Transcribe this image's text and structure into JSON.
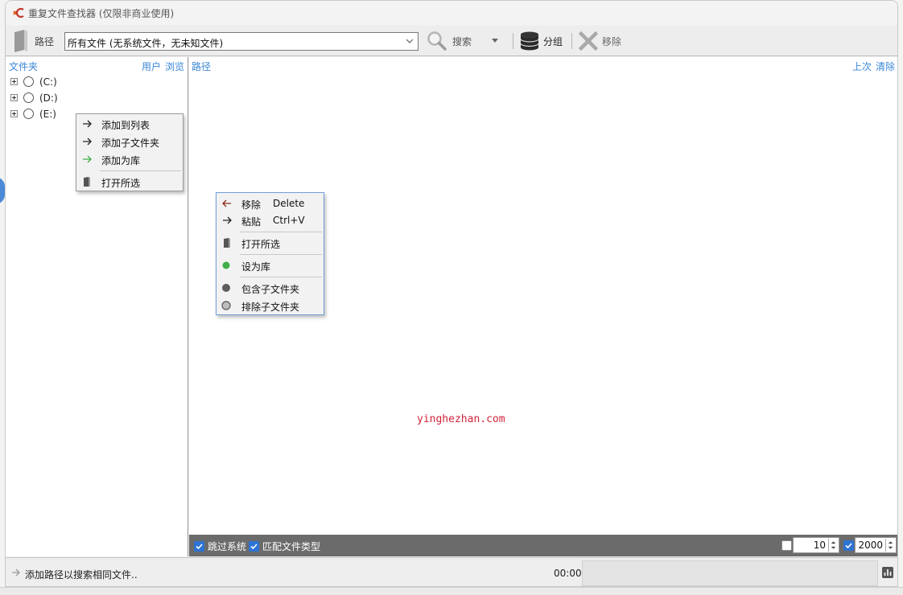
{
  "window": {
    "title": "重复文件查找器 (仅限非商业使用)"
  },
  "toolbar": {
    "path_label": "路径",
    "path_value": "所有文件 (无系统文件，无未知文件)",
    "search_label": "搜索",
    "group_label": "分组",
    "remove_label": "移除"
  },
  "left_panel": {
    "title": "文件夹",
    "user_link": "用户",
    "browse_link": "浏览",
    "drives": [
      {
        "label": "(C:)"
      },
      {
        "label": "(D:)"
      },
      {
        "label": "(E:)"
      }
    ]
  },
  "folder_menu": {
    "items": [
      {
        "label": "添加到列表",
        "icon": "arrow-right-icon"
      },
      {
        "label": "添加子文件夹",
        "icon": "arrow-right-icon"
      },
      {
        "label": "添加为库",
        "icon": "green-arrow-right-icon"
      },
      {
        "label": "打开所选",
        "icon": "open-book-icon"
      }
    ]
  },
  "right_panel": {
    "title": "路径",
    "previous_link": "上次",
    "clear_link": "清除",
    "watermark": "yinghezhan.com"
  },
  "path_menu": {
    "items": [
      {
        "label": "移除",
        "shortcut": "Delete",
        "icon": "arrow-left-icon"
      },
      {
        "label": "粘贴",
        "shortcut": "Ctrl+V",
        "icon": "arrow-right-icon"
      },
      {
        "label": "打开所选",
        "icon": "open-book-icon"
      },
      {
        "label": "设为库",
        "icon": "green-dot-icon"
      },
      {
        "label": "包含子文件夹",
        "icon": "dark-dot-icon"
      },
      {
        "label": "排除子文件夹",
        "icon": "gray-dot-icon"
      }
    ]
  },
  "options": {
    "skip_system_label": "跳过系统",
    "skip_system_checked": true,
    "match_type_label": "匹配文件类型",
    "match_type_checked": true,
    "min_size_checked": false,
    "min_size_value": "10",
    "max_size_checked": true,
    "max_size_value": "2000"
  },
  "status": {
    "message": "添加路径以搜索相同文件..",
    "time": "00:00"
  },
  "colors": {
    "accent": "#3a86d6",
    "options_bar": "#6b6b6b",
    "checkbox": "#2d73d4",
    "watermark": "#d2243b",
    "library_green": "#3fae49"
  }
}
